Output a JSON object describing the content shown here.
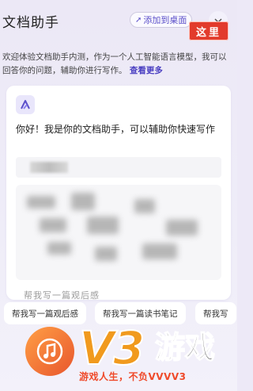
{
  "header": {
    "title": "文档助手",
    "pin_label": "添加到桌面",
    "icons": {
      "pin": "pin-icon",
      "collapse": "chevron-down-icon"
    }
  },
  "annotation": {
    "label": "这里",
    "color": "#e23b2c"
  },
  "intro": {
    "text": "欢迎体验文档助手内测，作为一个人工智能语言模型，我可以回答你的问题，辅助你进行写作。",
    "more_link": "查看更多"
  },
  "chat": {
    "avatar_icon": "assistant-logo-icon",
    "greeting": "你好！我是你的文档助手，可以辅助你快速写作",
    "partial_text": "帮我写一篇观后感"
  },
  "suggestions": [
    {
      "label": "帮我写一篇观后感"
    },
    {
      "label": "帮我写一篇读书笔记"
    },
    {
      "label": "帮我写"
    }
  ],
  "watermark": {
    "brand": "V3",
    "brand_cn": "游戏",
    "slogan": "游戏人生，不负VVVV3"
  },
  "colors": {
    "accent": "#4a3fc1",
    "background": "#ede9f7",
    "watermark_orange": "#f19a1e"
  }
}
